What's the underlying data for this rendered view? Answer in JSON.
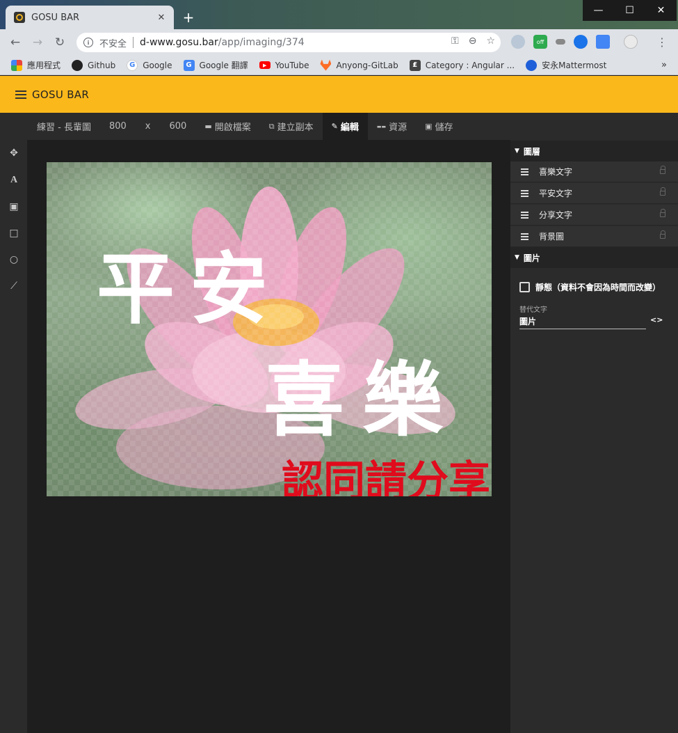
{
  "browser": {
    "tab_title": "GOSU BAR",
    "tab_close": "✕",
    "new_tab": "+",
    "window_controls": {
      "minimize": "—",
      "maximize": "☐",
      "close": "✕"
    },
    "nav": {
      "back": "←",
      "forward": "→",
      "reload": "↻"
    },
    "security_label": "不安全",
    "url_host": "d-www.gosu.bar",
    "url_path": "/app/imaging/374",
    "omnibox_icons": {
      "key": "⚿",
      "zoom": "⊖",
      "star": "☆"
    },
    "extensions": {
      "ext_off_badge": "off"
    },
    "menu": "⋮",
    "bookmarks": [
      {
        "label": "應用程式",
        "icon": "apps-grid-icon",
        "color": "#e8453c"
      },
      {
        "label": "Github",
        "icon": "github-icon",
        "color": "#222222"
      },
      {
        "label": "Google",
        "icon": "google-icon",
        "color": "#4285f4"
      },
      {
        "label": "Google 翻譯",
        "icon": "google-translate-icon",
        "color": "#4285f4"
      },
      {
        "label": "YouTube",
        "icon": "youtube-icon",
        "color": "#ff0000"
      },
      {
        "label": "Anyong-GitLab",
        "icon": "gitlab-icon",
        "color": "#fc6d26"
      },
      {
        "label": "Category : Angular ...",
        "icon": "category-icon",
        "color": "#444444"
      },
      {
        "label": "安永Mattermost",
        "icon": "mattermost-icon",
        "color": "#1e5fd9"
      }
    ],
    "bookmarks_more": "»"
  },
  "app": {
    "title": "GOSU BAR",
    "accent_color": "#fbb81b"
  },
  "editor_menu": {
    "doc_name": "練習 - 長輩圖",
    "width": "800",
    "times": "x",
    "height": "600",
    "open_file": "開啟檔案",
    "duplicate": "建立副本",
    "edit": "編輯",
    "resources": "資源",
    "save": "儲存"
  },
  "tools": [
    {
      "name": "move-tool",
      "glyph": "✥"
    },
    {
      "name": "text-tool",
      "glyph": "A"
    },
    {
      "name": "image-tool",
      "glyph": "▣"
    },
    {
      "name": "rectangle-tool",
      "glyph": "□"
    },
    {
      "name": "circle-tool",
      "glyph": "○"
    },
    {
      "name": "chart-tool",
      "glyph": "⟋"
    }
  ],
  "canvas": {
    "text_pingan": "平安",
    "text_xile": "喜樂",
    "text_share": "認同請分享",
    "share_color": "#e00b1c"
  },
  "panel": {
    "layers_title": "圖層",
    "layers": [
      "喜樂文字",
      "平安文字",
      "分享文字",
      "背景圖"
    ],
    "image_title": "圖片",
    "static_checkbox_label": "靜態（資料不會因為時間而改變）",
    "alt_text_label": "替代文字",
    "alt_text_value": "圖片",
    "code_toggle": "<>"
  }
}
